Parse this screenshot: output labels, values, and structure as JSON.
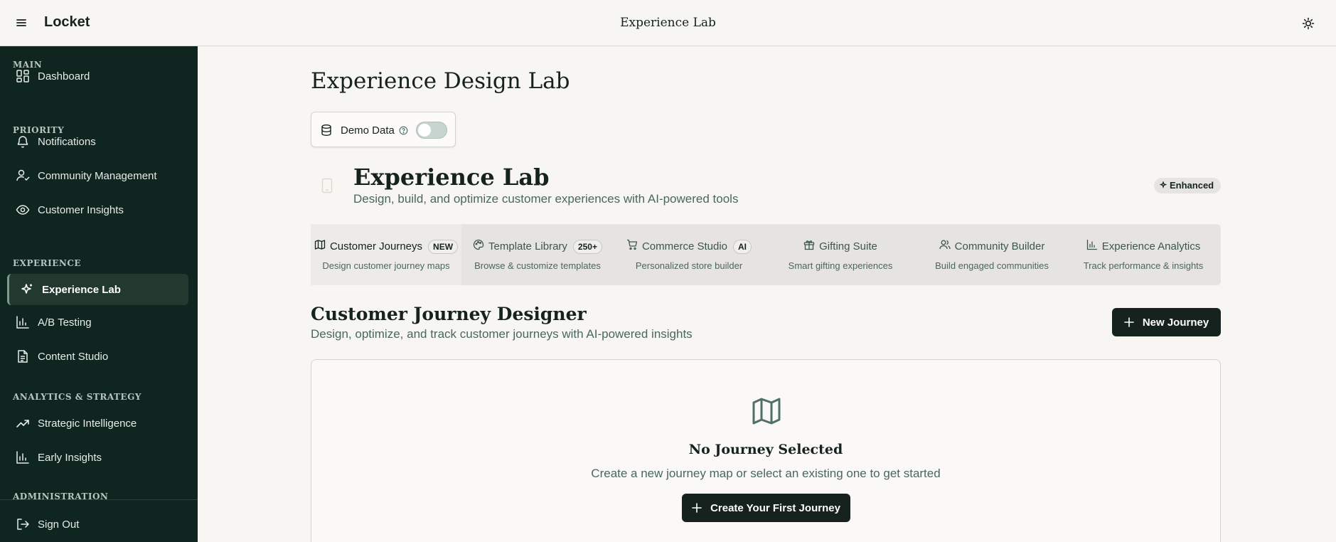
{
  "topbar": {
    "brand": "Locket",
    "title": "Experience Lab"
  },
  "sidebar": {
    "sections": [
      "MAIN",
      "PRIORITY",
      "EXPERIENCE",
      "ANALYTICS & STRATEGY",
      "ADMINISTRATION"
    ],
    "items": [
      {
        "label": "Dashboard",
        "icon": "dashboard-icon"
      },
      {
        "label": "Notifications",
        "icon": "bell-icon"
      },
      {
        "label": "Community Management",
        "icon": "user-check-icon"
      },
      {
        "label": "Customer Insights",
        "icon": "eye-icon"
      },
      {
        "label": "Experience Lab",
        "icon": "sparkles-icon",
        "active": true
      },
      {
        "label": "A/B Testing",
        "icon": "bar-chart-icon"
      },
      {
        "label": "Content Studio",
        "icon": "document-icon"
      },
      {
        "label": "Strategic Intelligence",
        "icon": "trending-up-icon"
      },
      {
        "label": "Early Insights",
        "icon": "bar-chart-icon"
      },
      {
        "label": "Sign Out",
        "icon": "sign-out-icon"
      }
    ]
  },
  "main": {
    "page_title": "Experience Design Lab",
    "demo": {
      "label": "Demo Data",
      "enabled": false
    },
    "hero": {
      "title": "Experience Lab",
      "subtitle": "Design, build, and optimize customer experiences with AI-powered tools",
      "badge": "Enhanced"
    },
    "tabs": [
      {
        "label": "Customer Journeys",
        "badge": "NEW",
        "desc": "Design customer journey maps",
        "icon": "map-icon",
        "active": true
      },
      {
        "label": "Template Library",
        "badge": "250+",
        "desc": "Browse & customize templates",
        "icon": "palette-icon"
      },
      {
        "label": "Commerce Studio",
        "badge": "AI",
        "desc": "Personalized store builder",
        "icon": "cart-icon"
      },
      {
        "label": "Gifting Suite",
        "badge": "",
        "desc": "Smart gifting experiences",
        "icon": "gift-icon"
      },
      {
        "label": "Community Builder",
        "badge": "",
        "desc": "Build engaged communities",
        "icon": "users-icon"
      },
      {
        "label": "Experience Analytics",
        "badge": "",
        "desc": "Track performance & insights",
        "icon": "bar-chart-icon"
      }
    ],
    "designer": {
      "title": "Customer Journey Designer",
      "subtitle": "Design, optimize, and track customer journeys with AI-powered insights",
      "new_button": "New Journey"
    },
    "empty": {
      "title": "No Journey Selected",
      "subtitle": "Create a new journey map or select an existing one to get started",
      "button": "Create Your First Journey"
    }
  },
  "colors": {
    "sidebar_bg": "#0f2620",
    "page_bg": "#f8f6f3",
    "primary_button": "#15221d",
    "accent_icon": "#4f6f67"
  }
}
